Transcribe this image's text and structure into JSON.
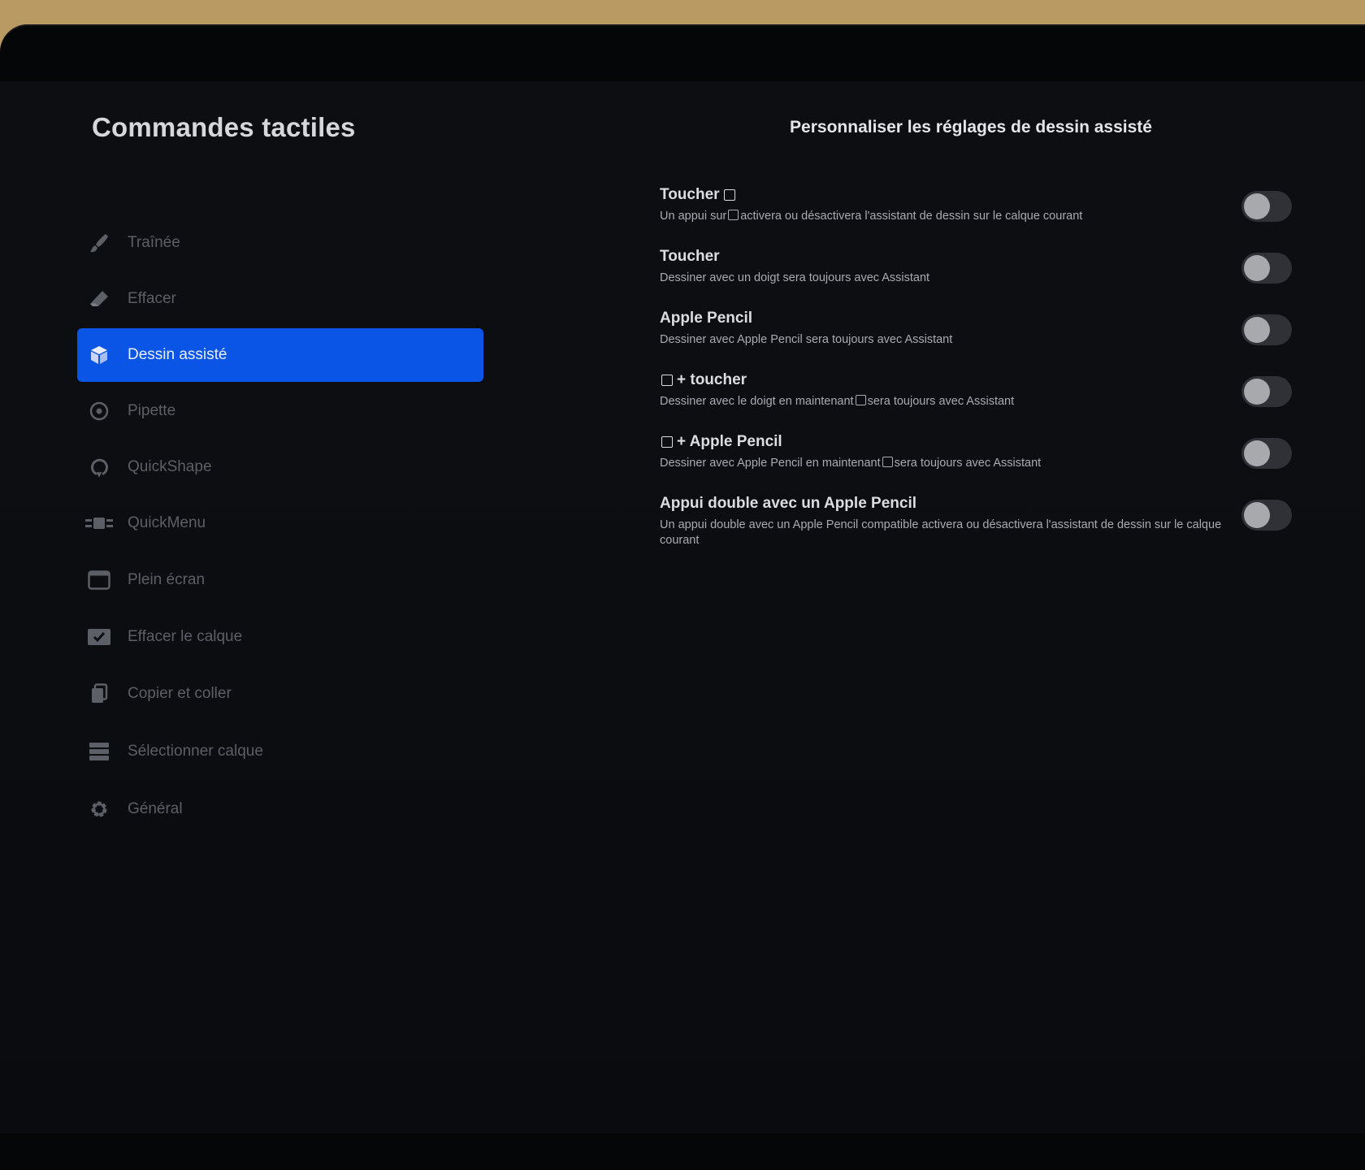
{
  "sidebar": {
    "title": "Commandes tactiles",
    "items": [
      {
        "label": "Traînée",
        "icon": "brush-icon",
        "active": false
      },
      {
        "label": "Effacer",
        "icon": "eraser-icon",
        "active": false
      },
      {
        "label": "Dessin assisté",
        "icon": "cube-icon",
        "active": true
      },
      {
        "label": "Pipette",
        "icon": "eyedropper-icon",
        "active": false
      },
      {
        "label": "QuickShape",
        "icon": "quickshape-icon",
        "active": false
      },
      {
        "label": "QuickMenu",
        "icon": "quickmenu-icon",
        "active": false
      },
      {
        "label": "Plein écran",
        "icon": "fullscreen-icon",
        "active": false
      },
      {
        "label": "Effacer le calque",
        "icon": "checkbox-icon",
        "active": false
      },
      {
        "label": "Copier et coller",
        "icon": "copy-icon",
        "active": false
      },
      {
        "label": "Sélectionner calque",
        "icon": "layers-icon",
        "active": false
      },
      {
        "label": "Général",
        "icon": "gear-icon",
        "active": false
      }
    ]
  },
  "main": {
    "title": "Personnaliser les réglages de dessin assisté",
    "settings": [
      {
        "title_before": "Toucher",
        "title_after": "",
        "desc_before": "Un appui sur",
        "desc_after": "activera ou désactivera l'assistant de dessin sur le calque courant",
        "enabled": false
      },
      {
        "title_before": "Toucher",
        "desc_before": "Dessiner avec un doigt sera toujours avec Assistant",
        "enabled": false
      },
      {
        "title_before": "Apple Pencil",
        "desc_before": "Dessiner avec Apple Pencil sera toujours avec Assistant",
        "enabled": false
      },
      {
        "title_before": "",
        "title_after": "+ toucher",
        "desc_before": "Dessiner avec le doigt en maintenant",
        "desc_after": "sera toujours avec Assistant",
        "enabled": false
      },
      {
        "title_before": "",
        "title_after": "+ Apple Pencil",
        "desc_before": "Dessiner avec Apple Pencil en maintenant",
        "desc_after": "sera toujours avec Assistant",
        "enabled": false
      },
      {
        "title_before": "Appui double avec un Apple Pencil",
        "desc_before": "Un appui double avec un Apple Pencil compatible activera ou désactivera l'assistant de dessin sur le calque courant",
        "enabled": false
      }
    ]
  },
  "colors": {
    "accent": "#0a55e6",
    "background": "#0b0d11",
    "toggle_off": "#2f3137"
  }
}
